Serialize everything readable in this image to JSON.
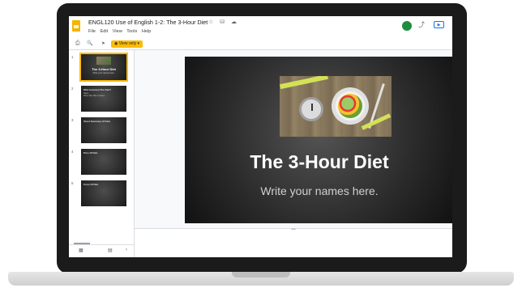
{
  "doc": {
    "title": "ENGL120 Use of English 1-2: The 3-Hour Diet",
    "title_icons": "☆ ⛁ ☁"
  },
  "menu": [
    "File",
    "Edit",
    "View",
    "Tools",
    "Help"
  ],
  "toolbar": {
    "print_icon": "⎙",
    "zoom_icon": "🔍",
    "pointer_icon": "➤",
    "view_only_label": "View only"
  },
  "header": {
    "avatar_letter": "",
    "trend_icon": "⤴",
    "present_icon": "▶"
  },
  "slides": [
    {
      "num": "1",
      "title": "The 3-Hour Diet",
      "subtitle": "Write your names here.",
      "selected": true
    },
    {
      "num": "2",
      "title": "Who Invented The Diet?",
      "subtitle": "Name\nWhen Diet Was Created"
    },
    {
      "num": "3",
      "title": "Short Summary Of Diet"
    },
    {
      "num": "4",
      "title": "Pros Of Diet"
    },
    {
      "num": "5",
      "title": "Cons Of Diet"
    }
  ],
  "filmstrip_bottom": {
    "grid_icon": "▦",
    "list_icon": "▤",
    "collapse_icon": "‹"
  },
  "main_slide": {
    "title": "The 3-Hour Diet",
    "subtitle": "Write your names here."
  },
  "notes_handle": "•••",
  "colors": {
    "accent": "#fbbc04",
    "slide_bg": "#2a2a2a",
    "laptop": "#1b1b1b"
  }
}
